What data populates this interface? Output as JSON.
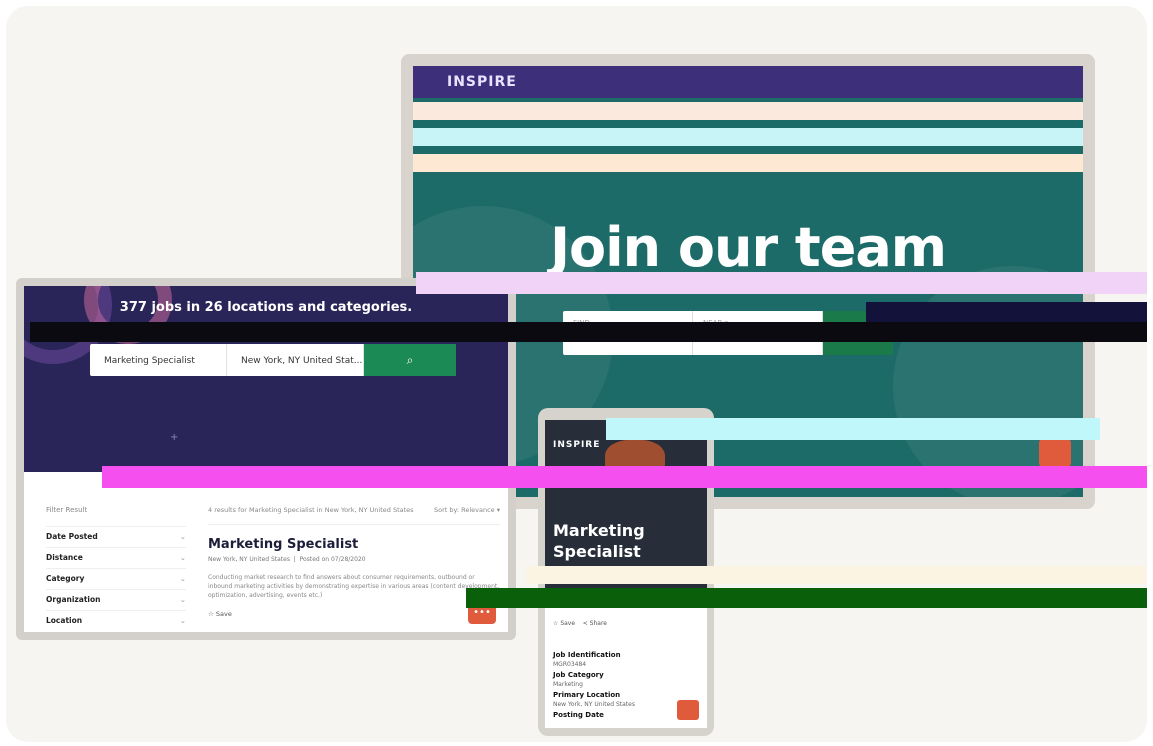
{
  "monitor": {
    "logo": "INSPIRE",
    "heading": "Join our team",
    "search_find_label": "FIND",
    "search_near_label": "NEAR ▾"
  },
  "laptop": {
    "hero_title": "377 jobs in 26 locations and categories.",
    "search_keyword_value": "Marketing Specialist",
    "search_location_value": "New York, NY United Stat...",
    "search_icon": "search-icon",
    "filter_title": "Filter Result",
    "filters": [
      {
        "label": "Date Posted"
      },
      {
        "label": "Distance"
      },
      {
        "label": "Category"
      },
      {
        "label": "Organization"
      },
      {
        "label": "Location"
      }
    ],
    "results_summary": "4 results for Marketing Specialist in New York, NY United States",
    "sort_label": "Sort by: Relevance ▾",
    "job": {
      "title": "Marketing Specialist",
      "location": "New York, NY United States",
      "posted": "Posted on 07/28/2020",
      "description": "Conducting market research to find answers about consumer requirements, outbound or inbound marketing activities by demonstrating expertise in various areas (content development, optimization, advertising, events etc.)",
      "save_label": "Save"
    }
  },
  "phone": {
    "logo": "INSPIRE",
    "title_line1": "Marketing",
    "title_line2": "Specialist",
    "save_label": "Save",
    "share_label": "Share",
    "details": [
      {
        "label": "Job Identification",
        "value": "MGR03484"
      },
      {
        "label": "Job Category",
        "value": "Marketing"
      },
      {
        "label": "Primary Location",
        "value": "New York, NY United States"
      },
      {
        "label": "Posting Date",
        "value": ""
      }
    ]
  },
  "colors": {
    "monitor_bg": "#1d6b69",
    "laptop_hero": "#2a2558",
    "accent_green": "#1c8a55",
    "chat_orange": "#e05a3c"
  }
}
